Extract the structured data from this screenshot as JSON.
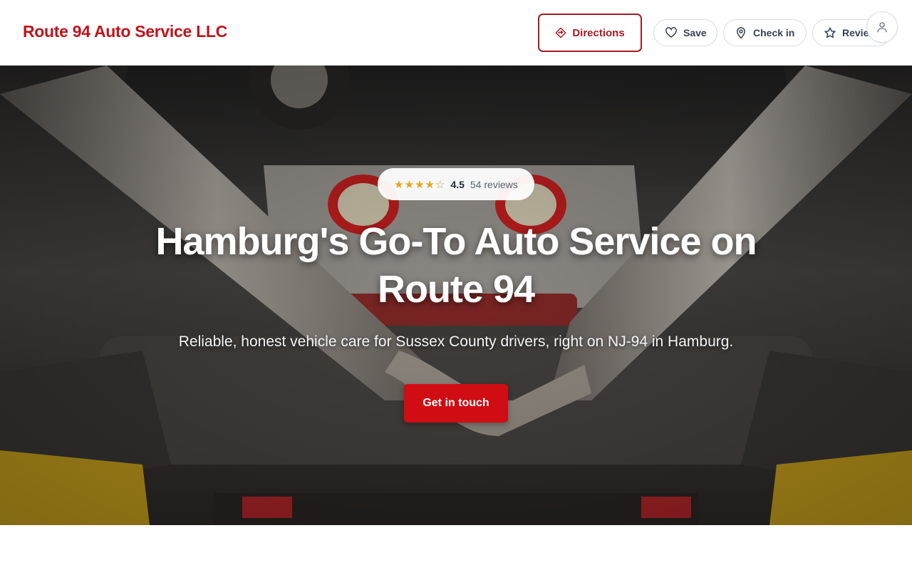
{
  "header": {
    "brand": "Route 94 Auto Service LLC",
    "directions_label": "Directions",
    "save_label": "Save",
    "checkin_label": "Check in",
    "review_label": "Review",
    "icons": {
      "directions": "directions-diamond-icon",
      "save": "heart-icon",
      "checkin": "map-pin-icon",
      "review": "star-icon",
      "account": "user-icon"
    }
  },
  "hero": {
    "background": "photo of car undercarriage with exhaust pipes on a lift",
    "rating": {
      "value": "4.5",
      "count": "54 reviews",
      "stars": 4.5
    },
    "title_line1": "Hamburg's Go-To Auto Service on",
    "title_line2": "Route 94",
    "subtitle": "Reliable, honest vehicle care for Sussex County drivers, right on NJ-94 in Hamburg.",
    "cta_label": "Get in touch"
  },
  "colors": {
    "brand": "#c0141b",
    "accent": "#cf0d12",
    "outline": "#a51c24",
    "star": "#e8a318"
  }
}
